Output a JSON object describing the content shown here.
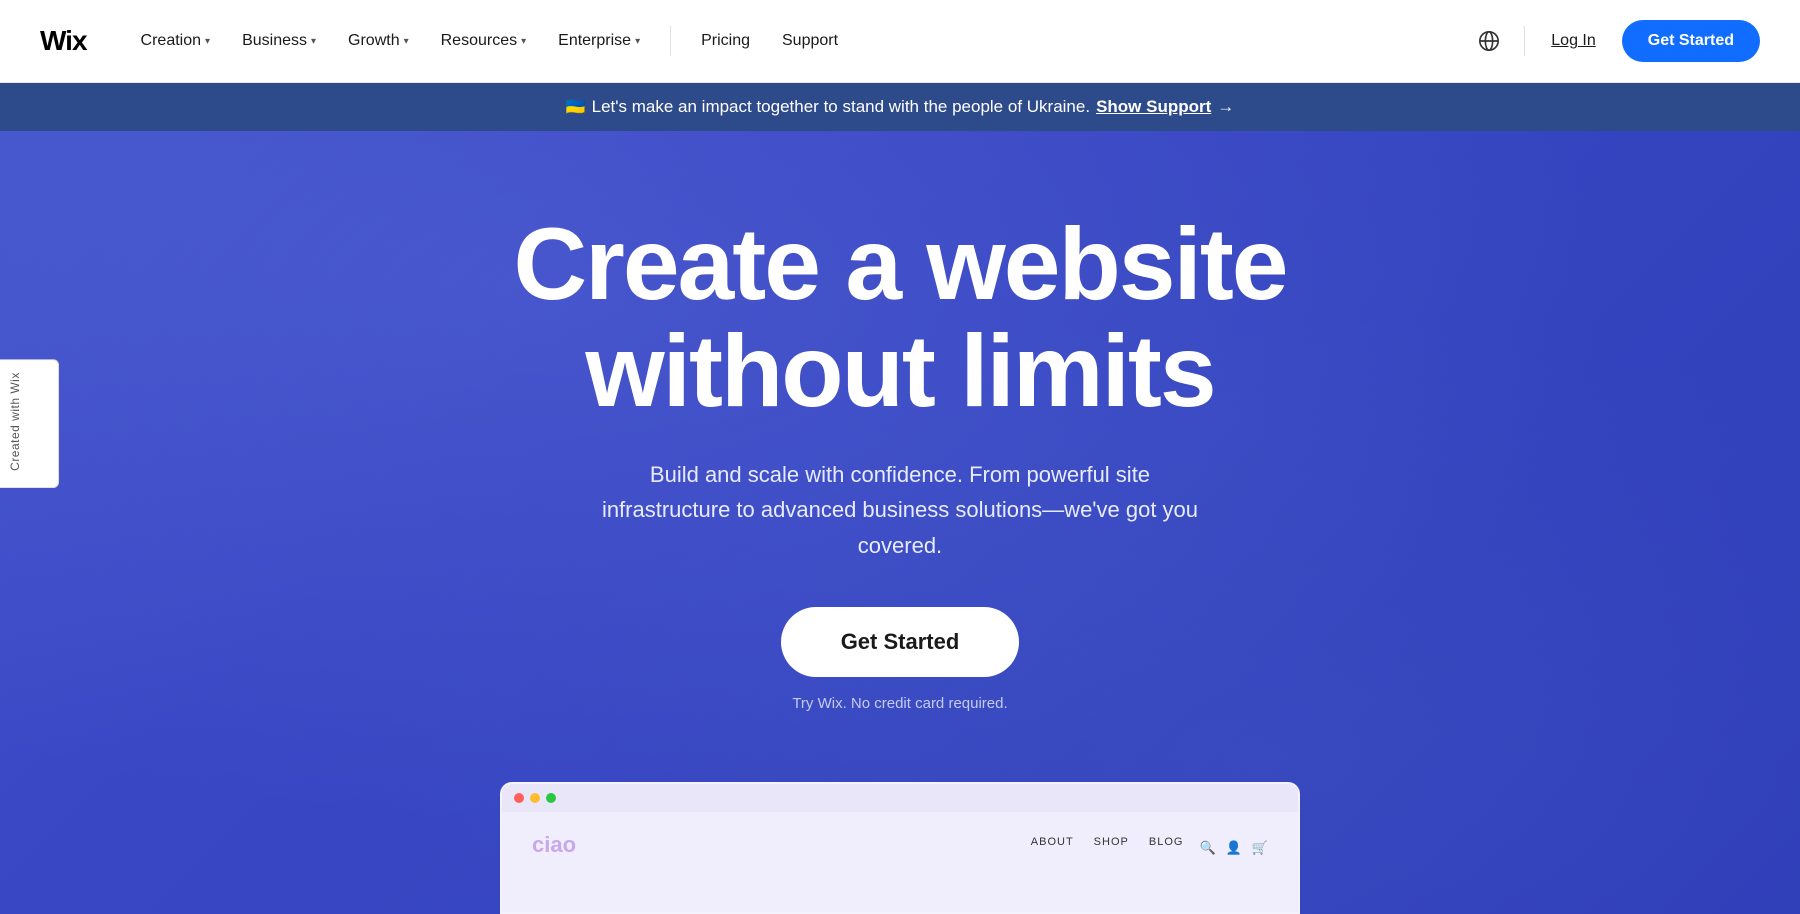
{
  "navbar": {
    "logo": "Wix",
    "nav_items": [
      {
        "label": "Creation",
        "has_dropdown": true
      },
      {
        "label": "Business",
        "has_dropdown": true
      },
      {
        "label": "Growth",
        "has_dropdown": true
      },
      {
        "label": "Resources",
        "has_dropdown": true
      },
      {
        "label": "Enterprise",
        "has_dropdown": true
      }
    ],
    "plain_items": [
      {
        "label": "Pricing"
      },
      {
        "label": "Support"
      }
    ],
    "login_label": "Log In",
    "get_started_label": "Get Started"
  },
  "banner": {
    "flag_emoji": "🇺🇦",
    "text": "Let's make an impact together to stand with the people of Ukraine.",
    "link_label": "Show Support",
    "arrow": "→"
  },
  "hero": {
    "title_line1": "Create a website",
    "title_line2": "without limits",
    "subtitle": "Build and scale with confidence. From powerful site infrastructure to advanced business solutions—we've got you covered.",
    "cta_label": "Get Started",
    "cta_sub": "Try Wix. No credit card required."
  },
  "browser_mockup": {
    "nav_items": [
      "ABOUT",
      "SHOP",
      "BLOG"
    ],
    "site_logo": "ciao"
  },
  "side_label": {
    "text": "Created with Wix"
  }
}
